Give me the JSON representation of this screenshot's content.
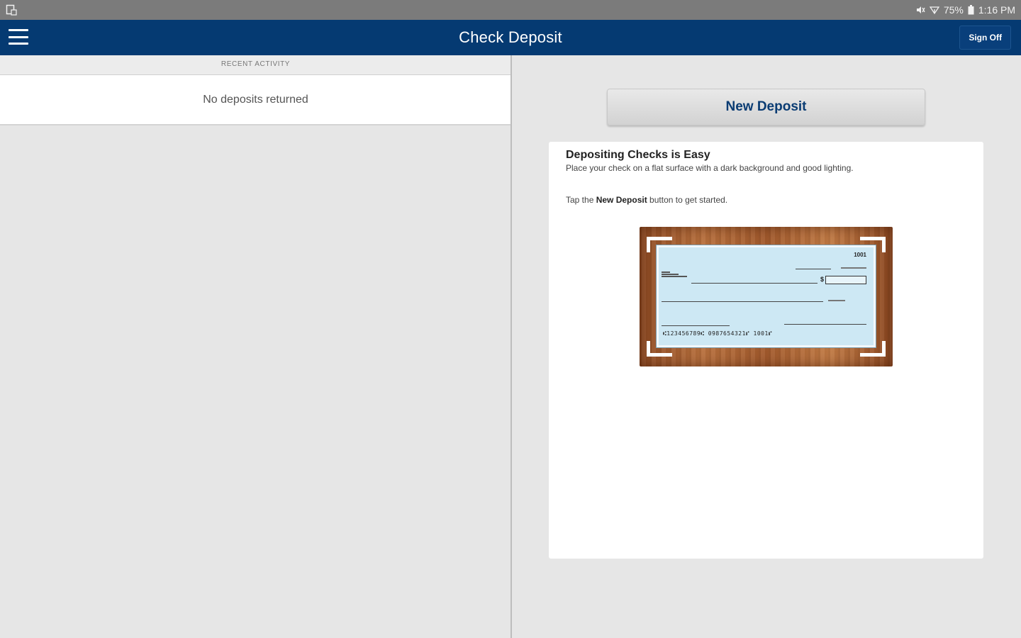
{
  "status_bar": {
    "battery": "75%",
    "time": "1:16 PM"
  },
  "app_bar": {
    "title": "Check Deposit",
    "sign_off_label": "Sign Off"
  },
  "recent_activity": {
    "header": "RECENT ACTIVITY",
    "empty_message": "No deposits returned"
  },
  "deposit": {
    "button_label": "New Deposit"
  },
  "info_card": {
    "heading": "Depositing Checks is Easy",
    "instruction": "Place your check on a flat surface with a dark background and good lighting.",
    "tap_prefix": "Tap the ",
    "tap_bold": "New Deposit",
    "tap_suffix": " button to get started."
  },
  "check_illustration": {
    "check_number": "1001",
    "micr_line": "⑆123456789⑆  0987654321⑈  1001⑈"
  },
  "colors": {
    "app_bar": "#053a72",
    "status_bar": "#7b7b7b",
    "button_text": "#0a3c73"
  }
}
